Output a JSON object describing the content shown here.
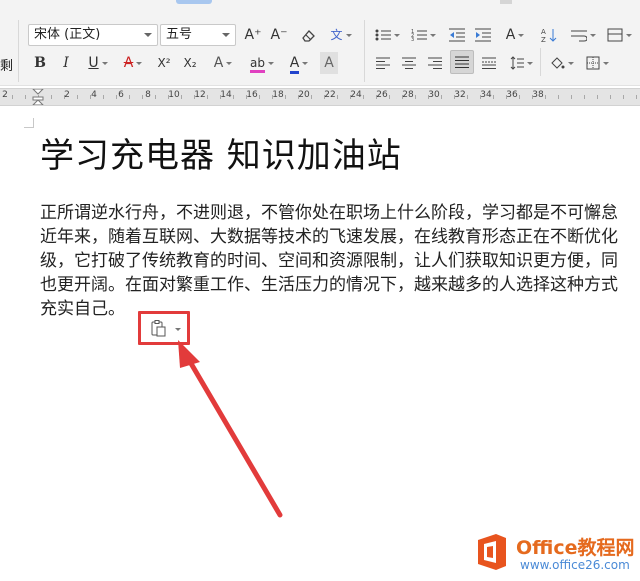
{
  "ribbon": {
    "cut_label": "剩",
    "font_name": "宋体 (正文)",
    "font_size": "五号",
    "bold": "B",
    "italic": "I",
    "underline": "U",
    "strikethrough": "A",
    "superscript": "X²",
    "subscript": "X₂",
    "text_effect": "A",
    "highlight": "ab",
    "font_color": "A",
    "char_shading": "A",
    "grow_font": "A⁺",
    "shrink_font": "A⁻",
    "phonetic": "文",
    "text_direction": "A",
    "colors": {
      "highlight": "#e040c0",
      "font_color": "#2244cc",
      "strike": "#cc2222",
      "background": "#f3f3f3"
    }
  },
  "ruler": {
    "ticks": [
      "2",
      "2",
      "4",
      "6",
      "8",
      "10",
      "12",
      "14",
      "16",
      "18",
      "20",
      "22",
      "24",
      "26",
      "28",
      "30",
      "32",
      "34",
      "36",
      "38"
    ]
  },
  "document": {
    "title": "学习充电器 知识加油站",
    "lines": [
      "正所谓逆水行舟，不进则退，不管你处在职场上什么阶段，学习都是不可懈怠",
      "近年来，随着互联网、大数据等技术的飞速发展，在线教育形态正在不断优化",
      "级，它打破了传统教育的时间、空间和资源限制，让人们获取知识更方便，同",
      "也更开阔。在面对繁重工作、生活压力的情况下，越来越多的人选择这种方式",
      "充实自己。"
    ]
  },
  "paste_options": {
    "icon": "clipboard-icon",
    "highlight_color": "#e23b3b"
  },
  "watermark": {
    "brand": "Office教程网",
    "url": "www.office26.com",
    "colors": {
      "brand": "#e56a1e",
      "url": "#4a8ad6",
      "logo": "#e8541e"
    }
  }
}
